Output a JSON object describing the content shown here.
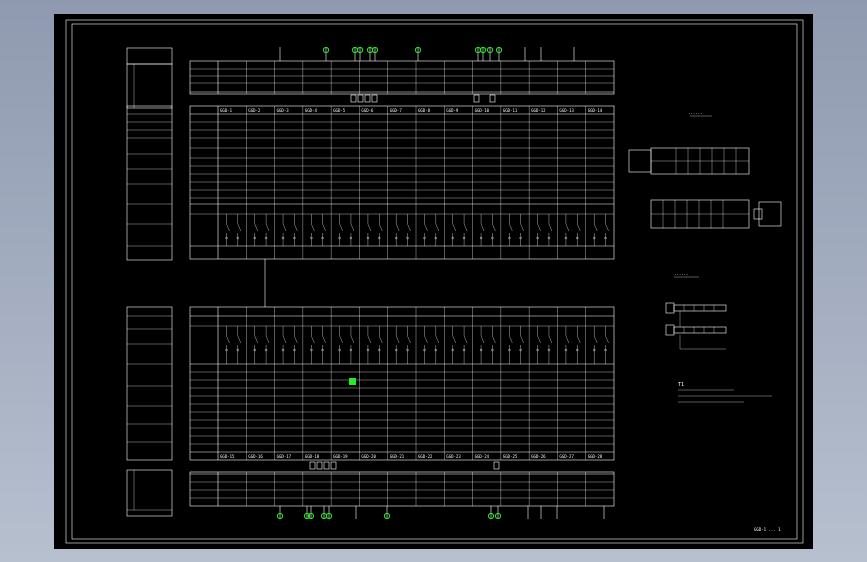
{
  "drawing": {
    "background": "#000000",
    "line_color": "#ffffff",
    "highlight_color": "#22ee22",
    "title_block_text": "GGD-1 ... 1",
    "note_label": "T1",
    "legend_caption": "......",
    "legend_caption_2": "......"
  },
  "tables": {
    "upper_header_cells": [
      "GGD-1",
      "GGD-2",
      "GGD-3",
      "GGD-4",
      "GGD-5",
      "GGD-6",
      "GGD-7",
      "GGD-8",
      "GGD-9",
      "GGD-10",
      "GGD-11",
      "GGD-12",
      "GGD-13",
      "GGD-14"
    ],
    "lower_header_cells": [
      "GGD-15",
      "GGD-16",
      "GGD-17",
      "GGD-18",
      "GGD-19",
      "GGD-20",
      "GGD-21",
      "GGD-22",
      "GGD-23",
      "GGD-24",
      "GGD-25",
      "GGD-26",
      "GGD-27",
      "GGD-28"
    ]
  }
}
